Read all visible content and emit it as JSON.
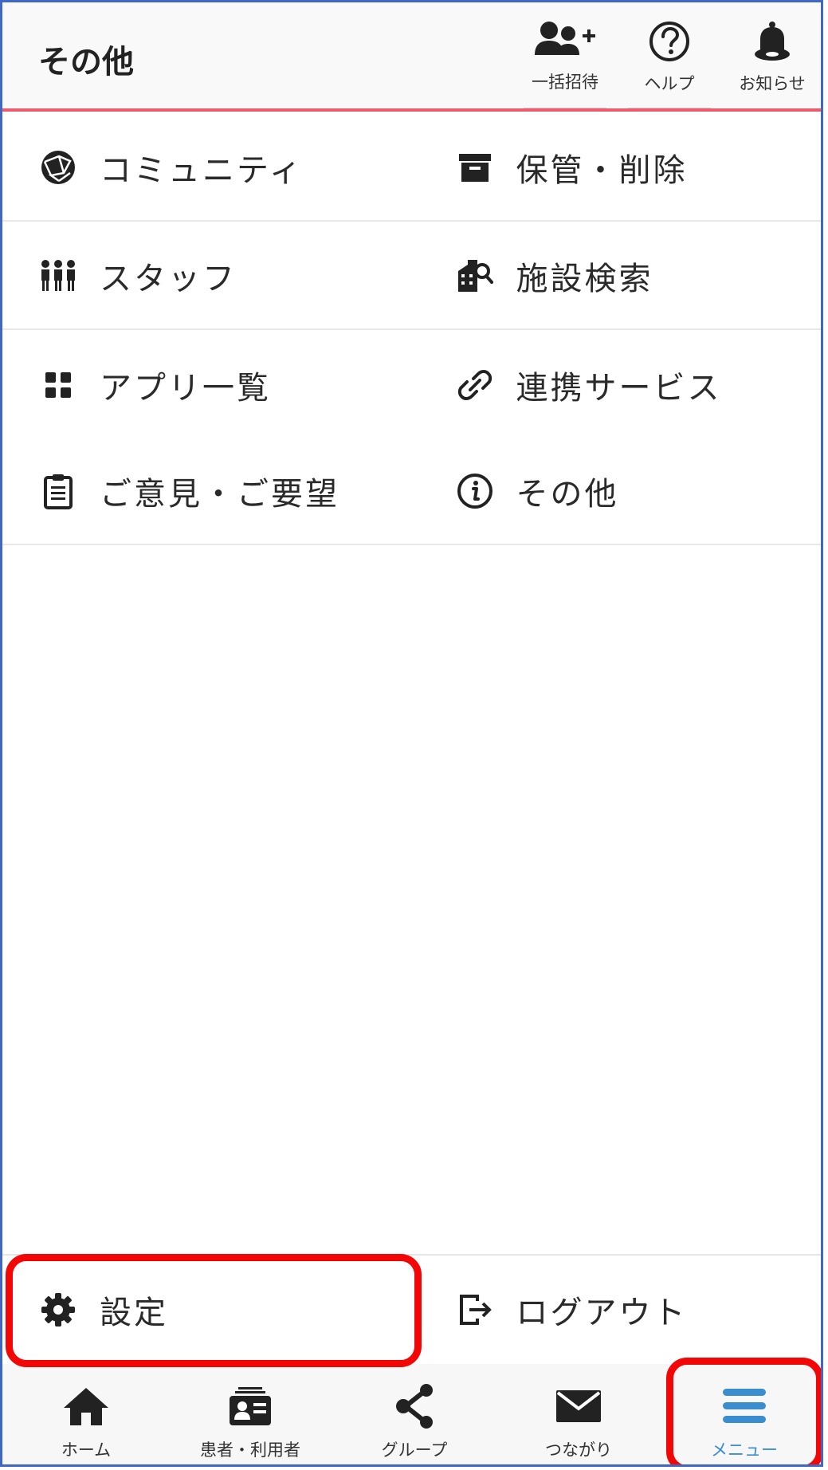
{
  "header": {
    "title": "その他",
    "actions": [
      {
        "label": "一括招待",
        "icon": "user-add-icon"
      },
      {
        "label": "ヘルプ",
        "icon": "help-circle-icon"
      },
      {
        "label": "お知らせ",
        "icon": "bell-icon"
      }
    ]
  },
  "menu": {
    "rows": [
      {
        "left": {
          "label": "コミュニティ",
          "icon": "globe-icon"
        },
        "right": {
          "label": "保管・削除",
          "icon": "archive-icon"
        }
      },
      {
        "left": {
          "label": "スタッフ",
          "icon": "staff-icon"
        },
        "right": {
          "label": "施設検索",
          "icon": "facility-search-icon"
        }
      },
      {
        "left": {
          "label": "アプリ一覧",
          "icon": "app-grid-icon"
        },
        "right": {
          "label": "連携サービス",
          "icon": "link-icon"
        }
      },
      {
        "left": {
          "label": "ご意見・ご要望",
          "icon": "clipboard-icon"
        },
        "right": {
          "label": "その他",
          "icon": "info-icon"
        }
      }
    ]
  },
  "bottom_actions": {
    "settings": {
      "label": "設定",
      "icon": "gear-icon"
    },
    "logout": {
      "label": "ログアウト",
      "icon": "logout-icon"
    }
  },
  "tabs": [
    {
      "label": "ホーム",
      "icon": "home-icon",
      "active": false
    },
    {
      "label": "患者・利用者",
      "icon": "patient-card-icon",
      "active": false
    },
    {
      "label": "グループ",
      "icon": "share-nodes-icon",
      "active": false
    },
    {
      "label": "つながり",
      "icon": "mail-icon",
      "active": false
    },
    {
      "label": "メニュー",
      "icon": "hamburger-menu-icon",
      "active": true
    }
  ],
  "colors": {
    "accent_red_line": "#ef5a6d",
    "highlight_red": "#f20606",
    "active_tab_blue": "#3a8ed0",
    "frame_blue": "#3f67c6"
  }
}
